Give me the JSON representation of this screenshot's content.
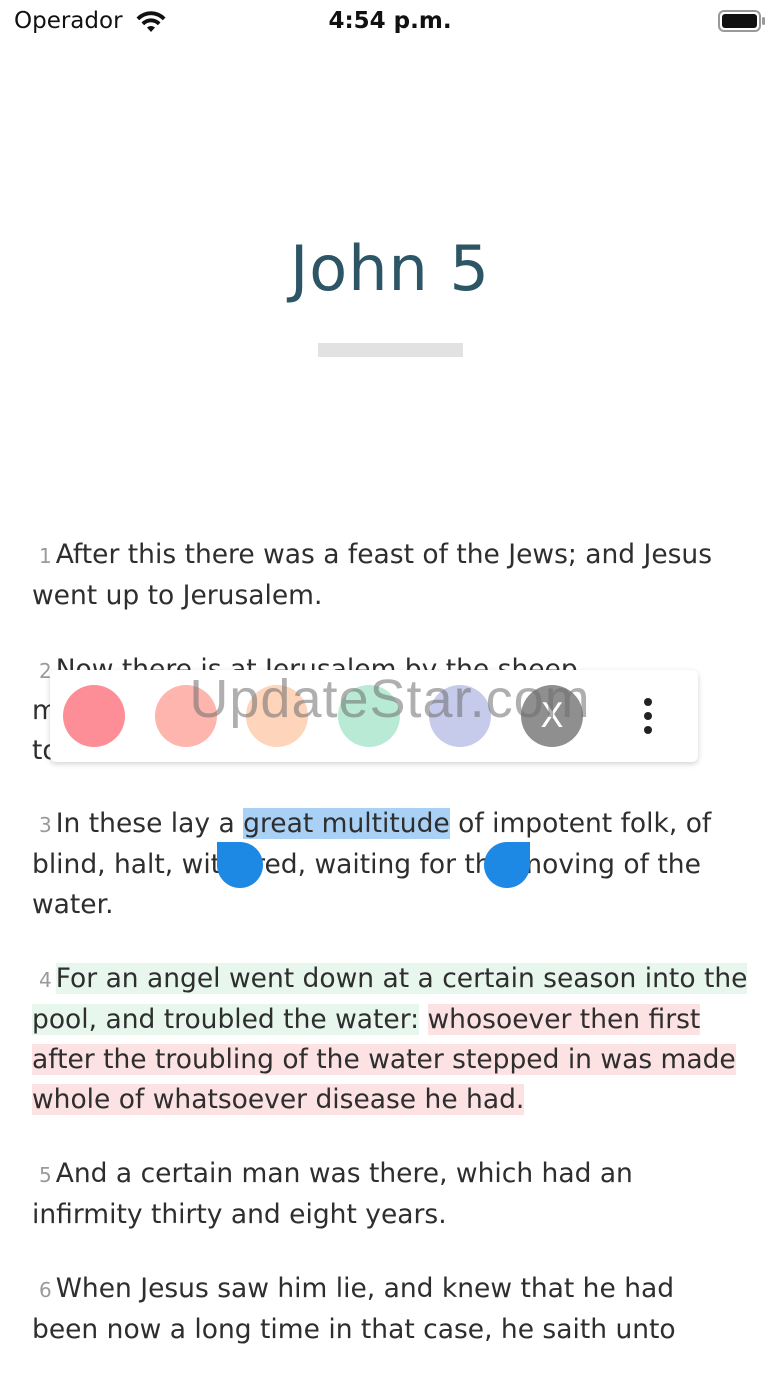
{
  "status_bar": {
    "carrier": "Operador",
    "time": "4:54 p.m.",
    "wifi_icon": "wifi-icon",
    "battery_icon": "battery-icon"
  },
  "chapter": {
    "title": "John 5"
  },
  "verses": [
    {
      "num": "1",
      "text": "After this there was a feast of the Jews; and Jesus went up to Jerusalem."
    },
    {
      "num": "2",
      "text_visible_top": "Now there is at Jerusalem by the sheep",
      "line2_start": "m",
      "line3_start": "to"
    },
    {
      "num": "3",
      "before": "In these lay a ",
      "selected": "great multitude",
      "after": " of impotent folk, of blind, halt, withered, waiting for the moving of the water."
    },
    {
      "num": "4",
      "green": "For an angel went down at a certain season into the pool, and troubled the water:",
      "pink": "whosoever then first after the troubling of the water stepped in was made whole of whatsoever disease he had."
    },
    {
      "num": "5",
      "text": "And a certain man was there, which had an infirmity thirty and eight years."
    },
    {
      "num": "6",
      "text": "When Jesus saw him lie, and knew that he had been now a long time in that case, he saith unto"
    }
  ],
  "toolbar": {
    "colors": [
      "#fd8d97",
      "#fdb5ae",
      "#fed5bb",
      "#b9ead6",
      "#c6cbec"
    ],
    "close_label": "X",
    "more_icon": "more-vertical-icon"
  },
  "selection_color": "#a9d1f5",
  "watermark": "UpdateStar.com"
}
